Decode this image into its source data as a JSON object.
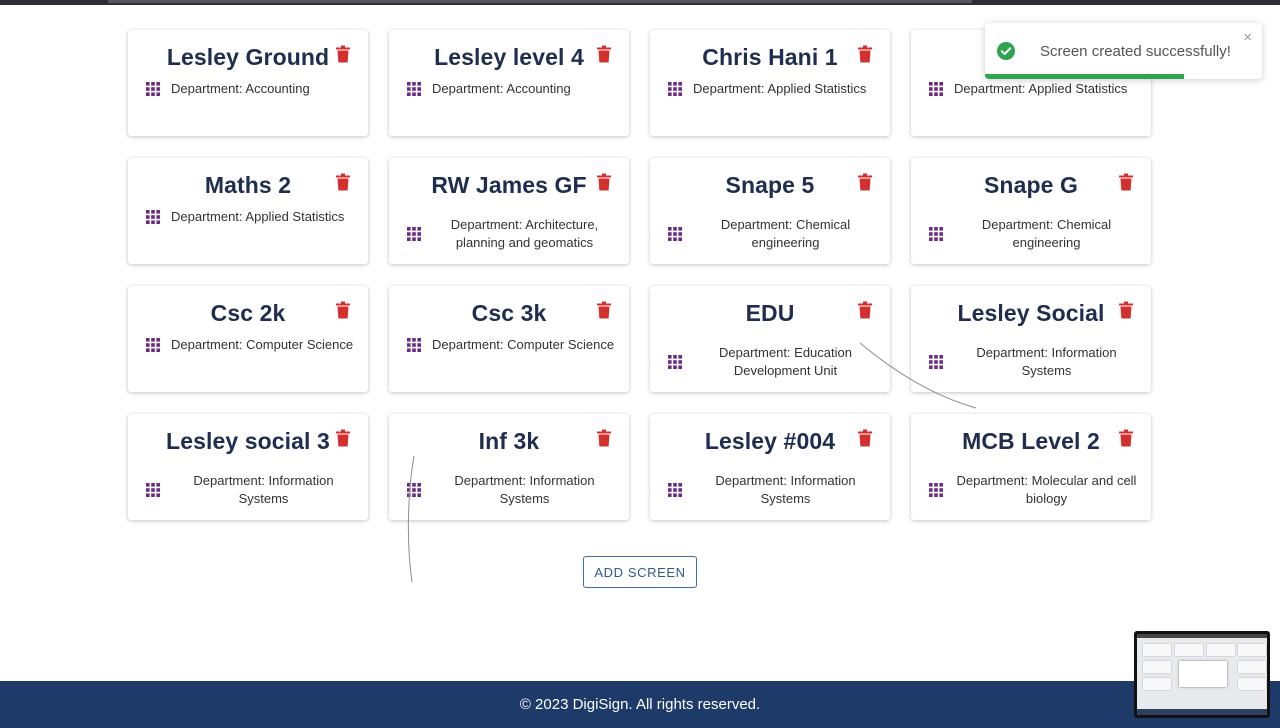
{
  "colors": {
    "trash": "#d32f2f",
    "grid_icon": "#6b2a83",
    "title": "#1f2d4e",
    "footer_bg": "#1e3a69",
    "toast_success": "#2ea44f",
    "add_button_border": "#3a6ea8"
  },
  "cards": [
    {
      "title": "Lesley Ground",
      "department": "Department: Accounting"
    },
    {
      "title": "Lesley level 4",
      "department": "Department: Accounting"
    },
    {
      "title": "Chris Hani 1",
      "department": "Department: Applied Statistics"
    },
    {
      "title": "",
      "department": "Department: Applied Statistics"
    },
    {
      "title": "Maths 2",
      "department": "Department: Applied Statistics"
    },
    {
      "title": "RW James GF",
      "department": "Department: Architecture, planning and geomatics"
    },
    {
      "title": "Snape 5",
      "department": "Department: Chemical engineering"
    },
    {
      "title": "Snape G",
      "department": "Department: Chemical engineering"
    },
    {
      "title": "Csc 2k",
      "department": "Department: Computer Science"
    },
    {
      "title": "Csc 3k",
      "department": "Department: Computer Science"
    },
    {
      "title": "EDU",
      "department": "Department: Education Development Unit"
    },
    {
      "title": "Lesley Social",
      "department": "Department: Information Systems"
    },
    {
      "title": "Lesley social 3",
      "department": "Department: Information Systems"
    },
    {
      "title": "Inf 3k",
      "department": "Department: Information Systems"
    },
    {
      "title": "Lesley #004",
      "department": "Department: Information Systems"
    },
    {
      "title": "MCB Level 2",
      "department": "Department: Molecular and cell biology"
    }
  ],
  "add_button_label": "ADD SCREEN",
  "footer_text": "© 2023 DigiSign. All rights reserved.",
  "toast": {
    "message": "Screen created successfully!",
    "close_glyph": "×",
    "progress": 0.72,
    "icon": "check-circle-icon"
  },
  "icons": {
    "delete": "trash-icon",
    "screen": "grid-icon"
  }
}
